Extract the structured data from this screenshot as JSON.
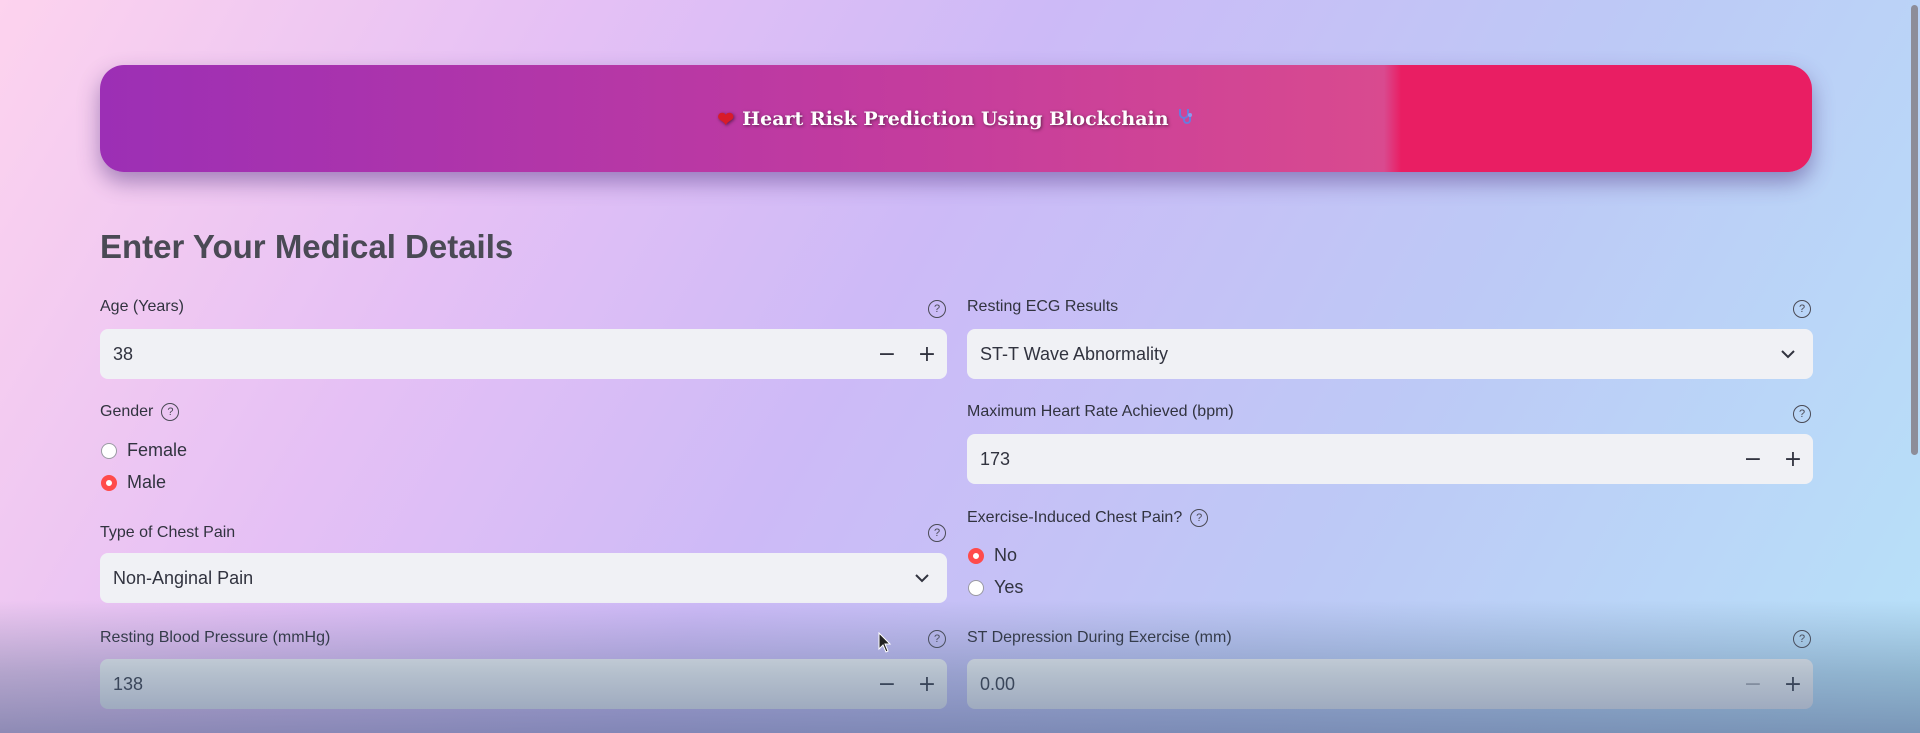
{
  "banner": {
    "title": "Heart Risk Prediction Using Blockchain",
    "left_icon": "heart-icon",
    "right_icon": "stethoscope-icon"
  },
  "section": {
    "title": "Enter Your Medical Details"
  },
  "fields": {
    "age": {
      "label": "Age (Years)",
      "value": "38"
    },
    "gender": {
      "label": "Gender",
      "options": [
        "Female",
        "Male"
      ],
      "selected": "Male"
    },
    "chest_pain": {
      "label": "Type of Chest Pain",
      "value": "Non-Anginal Pain"
    },
    "resting_bp": {
      "label": "Resting Blood Pressure (mmHg)",
      "value": "138"
    },
    "resting_ecg": {
      "label": "Resting ECG Results",
      "value": "ST-T Wave Abnormality"
    },
    "max_hr": {
      "label": "Maximum Heart Rate Achieved (bpm)",
      "value": "173"
    },
    "exercise_pain": {
      "label": "Exercise-Induced Chest Pain?",
      "options": [
        "No",
        "Yes"
      ],
      "selected": "No"
    },
    "st_depression": {
      "label": "ST Depression During Exercise (mm)",
      "value": "0.00"
    }
  },
  "glyphs": {
    "minus": "−",
    "plus": "+",
    "help": "?"
  },
  "colors": {
    "accent": "#ff4b4b",
    "banner_start": "#9c2fb5",
    "banner_end": "#e91e63"
  }
}
